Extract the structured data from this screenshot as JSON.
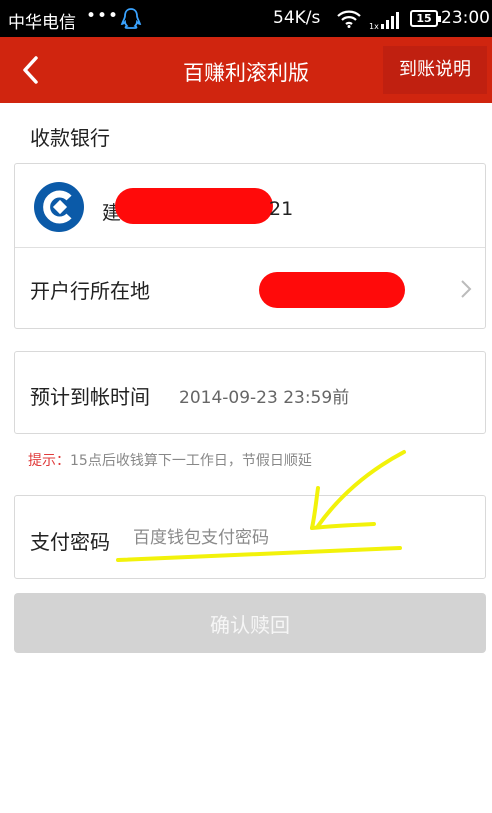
{
  "status_bar": {
    "carrier": "中华电信",
    "dots": "•••",
    "speed": "54K/s",
    "battery": "15",
    "time": "23:00",
    "icons": [
      "qq-icon",
      "wifi-icon",
      "signal-icon",
      "battery-icon"
    ]
  },
  "header": {
    "title": "百赚利滚利版",
    "help_label": "到账说明",
    "back_icon": "back-arrow-icon"
  },
  "receiving_bank": {
    "section_label": "收款银行",
    "bank_prefix": "建",
    "bank_suffix": "21",
    "bank_logo": "ccb-logo-icon",
    "region_label": "开户行所在地"
  },
  "arrival": {
    "label": "预计到帐时间",
    "value": "2014-09-23 23:59前"
  },
  "tip": {
    "key": "提示：",
    "text": "15点后收钱算下一工作日，节假日顺延"
  },
  "payment": {
    "label": "支付密码",
    "placeholder": "百度钱包支付密码",
    "value": ""
  },
  "confirm_button": {
    "label": "确认赎回"
  },
  "colors": {
    "nav_red": "#d0250f",
    "redaction": "#ff0a0a",
    "annotation": "#f2f20a",
    "button_disabled": "#d3d3d3"
  }
}
